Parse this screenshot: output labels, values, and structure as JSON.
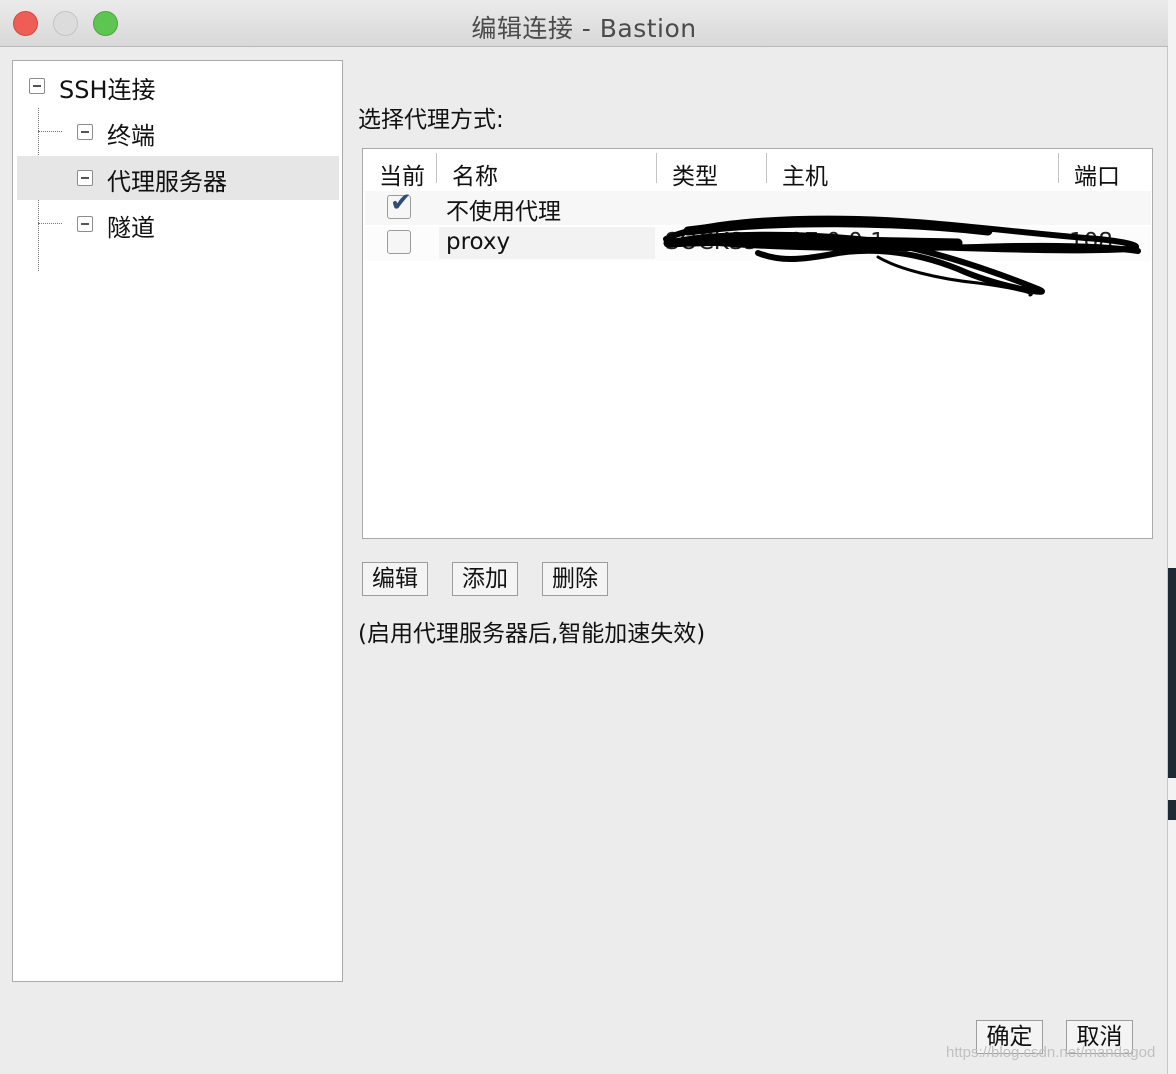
{
  "window": {
    "title": "编辑连接 - Bastion"
  },
  "tree": {
    "root": {
      "label": "SSH连接"
    },
    "children": [
      {
        "label": "终端",
        "selected": false
      },
      {
        "label": "代理服务器",
        "selected": true
      },
      {
        "label": "隧道",
        "selected": false
      }
    ]
  },
  "proxy": {
    "prompt": "选择代理方式:",
    "columns": [
      "当前",
      "名称",
      "类型",
      "主机",
      "端口"
    ],
    "rows": [
      {
        "checked": true,
        "name": "不使用代理",
        "type": "",
        "host": "",
        "port": ""
      },
      {
        "checked": false,
        "name": "proxy",
        "type": "SOCKS5",
        "host": "127.0.0.1",
        "port": "108..."
      }
    ],
    "buttons": {
      "edit": "编辑",
      "add": "添加",
      "delete": "删除"
    },
    "note": "(启用代理服务器后,智能加速失效)"
  },
  "footer": {
    "ok": "确定",
    "cancel": "取消"
  },
  "watermark": "https://blog.csdn.net/mandagod"
}
